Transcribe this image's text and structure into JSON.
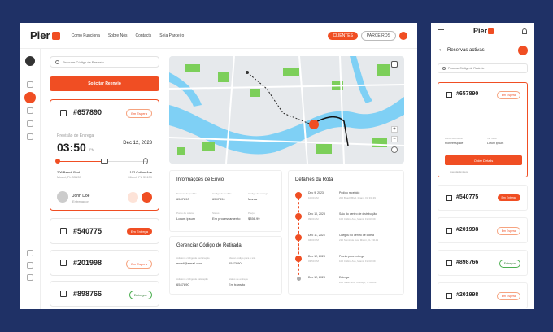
{
  "brand": "Pier",
  "nav": [
    "Como Funciona",
    "Sobre Nós",
    "Contacts",
    "Seja Parceiro"
  ],
  "header": {
    "clientes": "CLIENTES",
    "parceiros": "PARCEIROS"
  },
  "search": {
    "placeholder": "Procurar Código de Rastreio"
  },
  "request_button": "Solicitar Reenvio",
  "selected": {
    "id": "#657890",
    "status": "Em Espera",
    "forecast_label": "Previsão de Entrega",
    "time": "03:50",
    "time_unit": "PM",
    "date": "Dec 12, 2023",
    "from_address": "206 Beach Blvd",
    "from_city": "Miami, FL 33139",
    "to_address": "102 Collins Ave",
    "to_city": "Miami, FL 33139",
    "driver": "John Doe",
    "driver_role": "Entregador"
  },
  "shipments": [
    {
      "id": "#540775",
      "status": "Em Entrega",
      "type": "red"
    },
    {
      "id": "#201998",
      "status": "Em Espera",
      "type": "out"
    },
    {
      "id": "#898766",
      "status": "Entregue",
      "type": "grn"
    }
  ],
  "info": {
    "title": "Informações de Envio",
    "fields": [
      {
        "label": "Número de pedido",
        "value": "6547890"
      },
      {
        "label": "Código de pedido",
        "value": "6547890"
      },
      {
        "label": "Código de entrega",
        "value": "Marca"
      },
      {
        "label": "Ponto de coleta",
        "value": "Lorum ipsum"
      },
      {
        "label": "Status",
        "value": "Em processamento"
      },
      {
        "label": "Preço",
        "value": "$356.99"
      }
    ]
  },
  "pickup": {
    "title": "Gerenciar Código de Retirada",
    "fields": [
      {
        "label": "Adicione código de verificação",
        "value": "email@email.com"
      },
      {
        "label": "Alterar código para o site",
        "value": "6547890"
      },
      {
        "label": "Adicione código de validação",
        "value": "6547890"
      },
      {
        "label": "Status de entrega",
        "value": "Em trânsito"
      }
    ]
  },
  "route": {
    "title": "Detalhes da Rota",
    "steps": [
      {
        "date": "Dec 9, 2023",
        "time": "10:00 AM",
        "title": "Pedido recebido",
        "place": "206 Beach Blvd, Miami, FL 33139"
      },
      {
        "date": "Dec 10, 2023",
        "time": "09:00 AM",
        "title": "Saiu do centro de distribuição",
        "place": "102 Collins Ave, Miami, FL 33139"
      },
      {
        "date": "Dec 11, 2023",
        "time": "04:00 PM",
        "title": "Chegou no centro de coleta",
        "place": "210 Seminole Ave, Miami, FL 33139"
      },
      {
        "date": "Dec 12, 2023",
        "time": "03:50 PM",
        "title": "Pronto para entrega",
        "place": "102 Collins Ave, Miami, FL 33139"
      },
      {
        "date": "Dec 12, 2023",
        "time": "",
        "title": "Entrega",
        "place": "206 State Blvd, Chicago, IL 60603"
      }
    ]
  },
  "mobile": {
    "title": "Reservas activas",
    "search_placeholder": "Procurar Código de Rastreio",
    "selected_id": "#657890",
    "selected_status": "Em Espera",
    "fields": [
      {
        "label": "Ponto de Coleta",
        "value": "Pioneer space"
      },
      {
        "label": "Ver local",
        "value": "Lorum ipsum"
      }
    ],
    "button": "Order Details",
    "note": "Agendar Entrega",
    "items": [
      {
        "id": "#540775",
        "status": "Em Entrega",
        "type": "red"
      },
      {
        "id": "#201998",
        "status": "Em Espera",
        "type": "out"
      },
      {
        "id": "#898766",
        "status": "Entregue",
        "type": "grn"
      },
      {
        "id": "#201998",
        "status": "Em Espera",
        "type": "out"
      },
      {
        "id": "#201998",
        "status": "Em Espera",
        "type": "out"
      }
    ]
  },
  "colors": {
    "accent": "#f04e23",
    "bg": "#1f3166",
    "water": "#7fd0f5",
    "park": "#7ccf5a"
  }
}
